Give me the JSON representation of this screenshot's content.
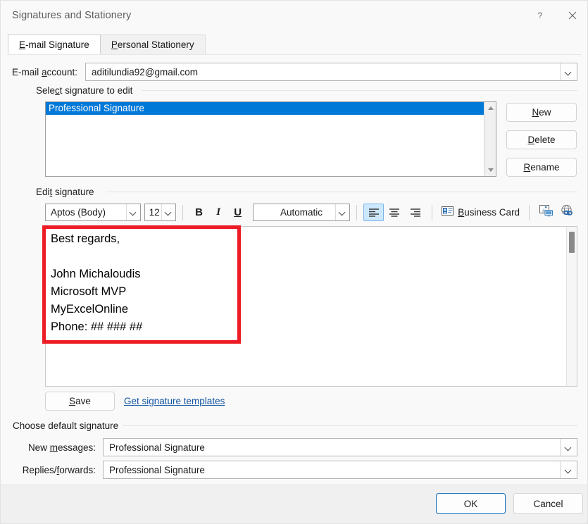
{
  "window": {
    "title": "Signatures and Stationery",
    "help_icon": "question-mark-icon",
    "close_icon": "close-icon"
  },
  "tabs": [
    {
      "label": "E-mail Signature",
      "accel": "E",
      "active": true
    },
    {
      "label": "Personal Stationery",
      "accel": "P",
      "active": false
    }
  ],
  "email_account": {
    "label_pre": "E-mail ",
    "label_accel": "a",
    "label_post": "ccount:",
    "value": "aditilundia92@gmail.com"
  },
  "select_signature": {
    "group_title_pre": "Sele",
    "group_title_accel": "c",
    "group_title_post": "t signature to edit",
    "items": [
      {
        "label": "Professional Signature",
        "selected": true
      }
    ],
    "buttons": [
      {
        "label_pre": "",
        "accel": "N",
        "label_post": "ew",
        "name": "new-signature-button"
      },
      {
        "label_pre": "",
        "accel": "D",
        "label_post": "elete",
        "name": "delete-signature-button"
      },
      {
        "label_pre": "",
        "accel": "R",
        "label_post": "ename",
        "name": "rename-signature-button"
      }
    ]
  },
  "edit_signature": {
    "group_title_pre": "Edi",
    "group_title_accel": "t",
    "group_title_post": " signature",
    "toolbar": {
      "font_family": "Aptos (Body)",
      "font_size": "12",
      "bold": "B",
      "italic": "I",
      "underline": "U",
      "font_color": "Automatic",
      "align_left_active": true,
      "business_card_pre": "",
      "business_card_accel": "B",
      "business_card_post": "usiness Card",
      "picture_icon": "insert-picture-icon",
      "hyperlink_icon": "insert-hyperlink-icon"
    },
    "content": "Best regards,\n\nJohn Michaloudis\nMicrosoft MVP\nMyExcelOnline\nPhone: ## ### ##",
    "save_button_pre": "",
    "save_button_accel": "S",
    "save_button_post": "ave",
    "templates_link": "Get signature templates"
  },
  "default_signature": {
    "group_title": "Choose default signature",
    "new_messages": {
      "label_pre": "New ",
      "label_accel": "m",
      "label_post": "essages:",
      "value": "Professional Signature"
    },
    "replies_forwards": {
      "label_pre": "Replies/",
      "label_accel": "f",
      "label_post": "orwards:",
      "value": "Professional Signature"
    }
  },
  "footer": {
    "ok_label": "OK",
    "cancel_label": "Cancel"
  },
  "annotation": {
    "highlight_color": "#ed1c24",
    "selection_color": "#0078d7",
    "link_color": "#1254a1"
  }
}
